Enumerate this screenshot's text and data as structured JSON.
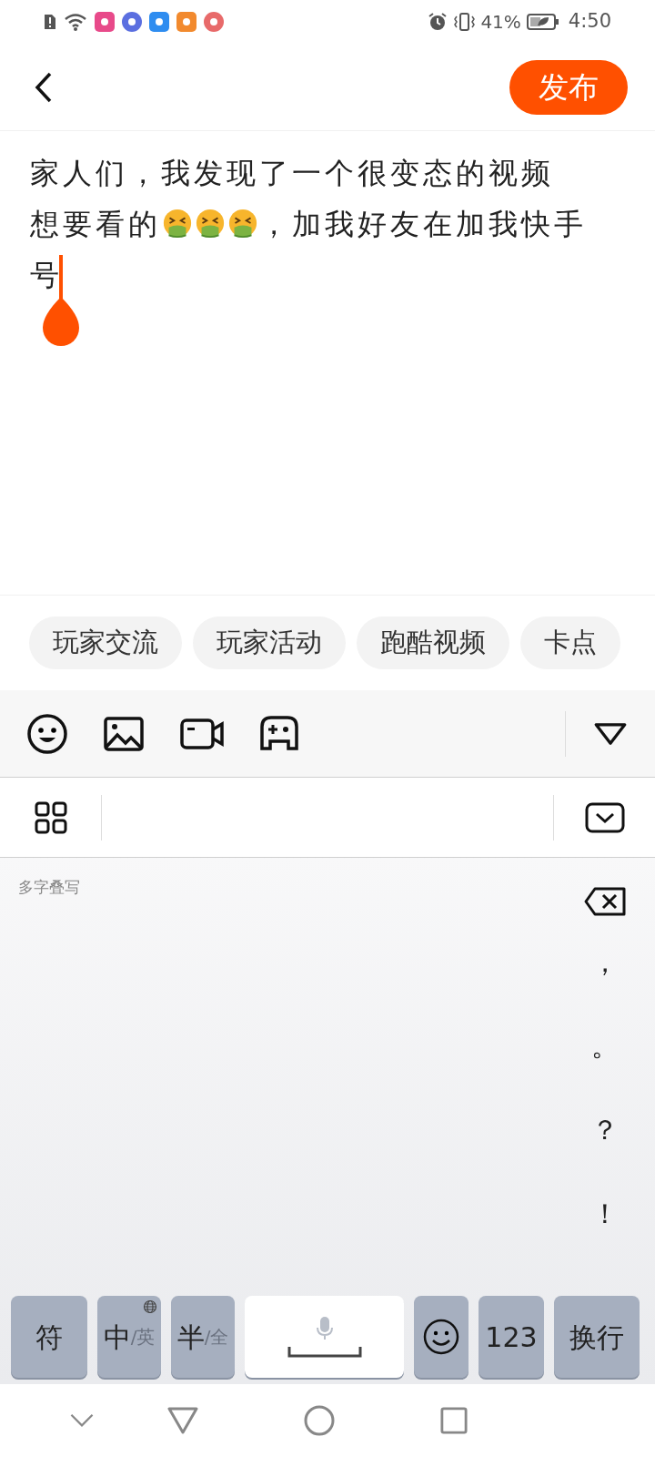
{
  "status_bar": {
    "battery": "41%",
    "time": "4:50"
  },
  "header": {
    "publish": "发布"
  },
  "post": {
    "lines": [
      [
        {
          "kind": "text",
          "text": "家人们，我发现了一个很变态的视频"
        }
      ],
      [
        {
          "kind": "text",
          "text": "想要看的"
        },
        {
          "kind": "emoji"
        },
        {
          "kind": "emoji"
        },
        {
          "kind": "emoji"
        },
        {
          "kind": "text",
          "text": "，加我好友在加我快手"
        }
      ],
      [
        {
          "kind": "text",
          "text": "号"
        }
      ]
    ]
  },
  "topics": [
    "玩家交流",
    "玩家活动",
    "跑酷视频",
    "卡点"
  ],
  "keyboard": {
    "mode_label": "多字叠写",
    "punctuation": [
      "，",
      "。",
      "？",
      "！"
    ],
    "keys": [
      {
        "kind": "plain",
        "text": "符"
      },
      {
        "kind": "toggle",
        "text": "中",
        "sub": "/英"
      },
      {
        "kind": "toggle",
        "text": "半",
        "sub": "/全"
      },
      {
        "kind": "space"
      },
      {
        "kind": "emoji"
      },
      {
        "kind": "plain",
        "text": "123"
      },
      {
        "kind": "plain",
        "text": "换行"
      }
    ]
  }
}
